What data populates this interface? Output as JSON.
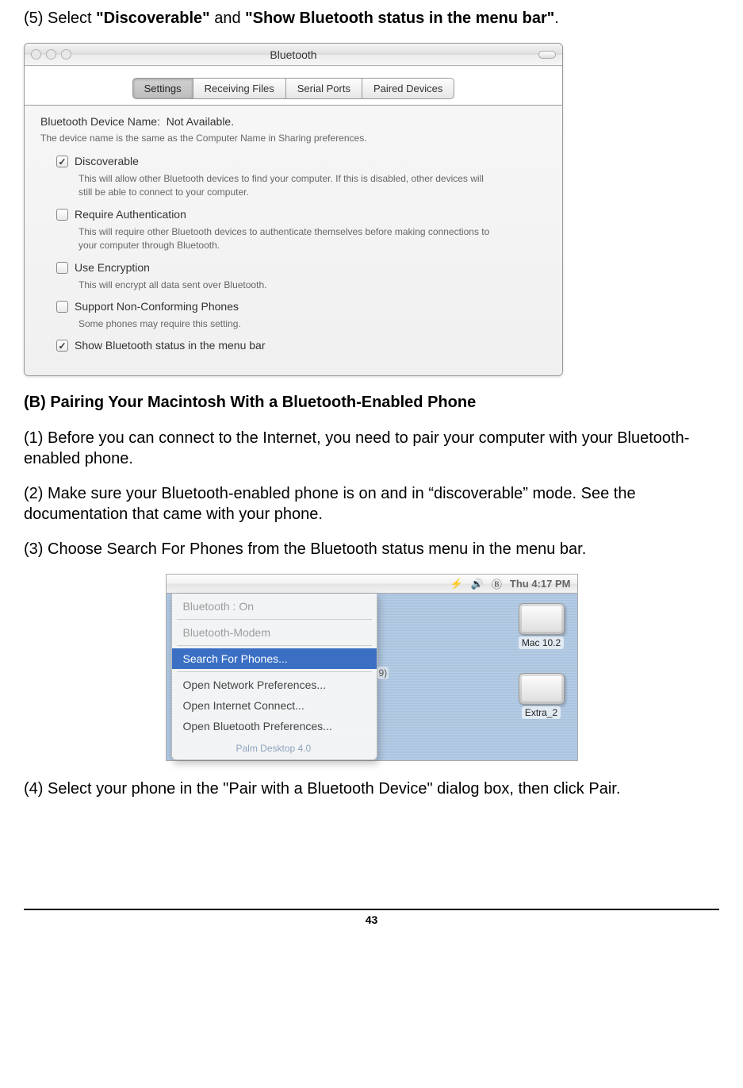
{
  "step5": {
    "prefix": "(5) Select ",
    "bold1": "\"Discoverable\"",
    "mid": " and ",
    "bold2": "\"Show Bluetooth status in the menu bar\"",
    "suffix": "."
  },
  "bt_window": {
    "title": "Bluetooth",
    "tabs": {
      "settings": "Settings",
      "receiving": "Receiving Files",
      "serial": "Serial Ports",
      "paired": "Paired Devices"
    },
    "device_name_label": "Bluetooth Device Name:",
    "device_name_value": "Not Available.",
    "device_note": "The device name is the same as the Computer Name in Sharing preferences.",
    "options": {
      "discoverable": {
        "label": "Discoverable",
        "desc": "This will allow other Bluetooth devices to find your computer.  If this is disabled, other devices will still be able to connect to your computer."
      },
      "auth": {
        "label": "Require Authentication",
        "desc": "This will require other Bluetooth devices to authenticate themselves before making connections to your computer through Bluetooth."
      },
      "encrypt": {
        "label": "Use Encryption",
        "desc": "This will encrypt all data sent over Bluetooth."
      },
      "noncon": {
        "label": "Support Non-Conforming Phones",
        "desc": "Some phones may require this setting."
      },
      "menubar": {
        "label": "Show Bluetooth status in the menu bar"
      }
    }
  },
  "section_b_heading": "(B) Pairing Your Macintosh With a Bluetooth-Enabled Phone",
  "step_b1": "(1) Before you can connect to the Internet, you need to pair your computer with your Bluetooth-enabled phone.",
  "step_b2": "(2) Make sure your Bluetooth-enabled phone is on and in “discoverable” mode. See the documentation that came with your phone.",
  "step_b3": "(3) Choose Search For Phones from the Bluetooth status menu in the menu bar.",
  "menubar_fig": {
    "clock": "Thu 4:17 PM",
    "bt_icon": "Ⓑ",
    "charge_icon": "⚡",
    "sound_icon": "🔊",
    "items": {
      "status": "Bluetooth : On",
      "modem": "Bluetooth-Modem",
      "search": "Search For Phones...",
      "net": "Open Network Preferences...",
      "inet": "Open Internet Connect...",
      "btpref": "Open Bluetooth Preferences..."
    },
    "badge": "9)",
    "hdd1": "Mac 10.2",
    "hdd2": "Extra_2",
    "faded_label": "Palm Desktop 4.0"
  },
  "step_b4": "(4) Select your phone in the \"Pair with a Bluetooth Device\" dialog box, then click Pair.",
  "page_number": "43"
}
